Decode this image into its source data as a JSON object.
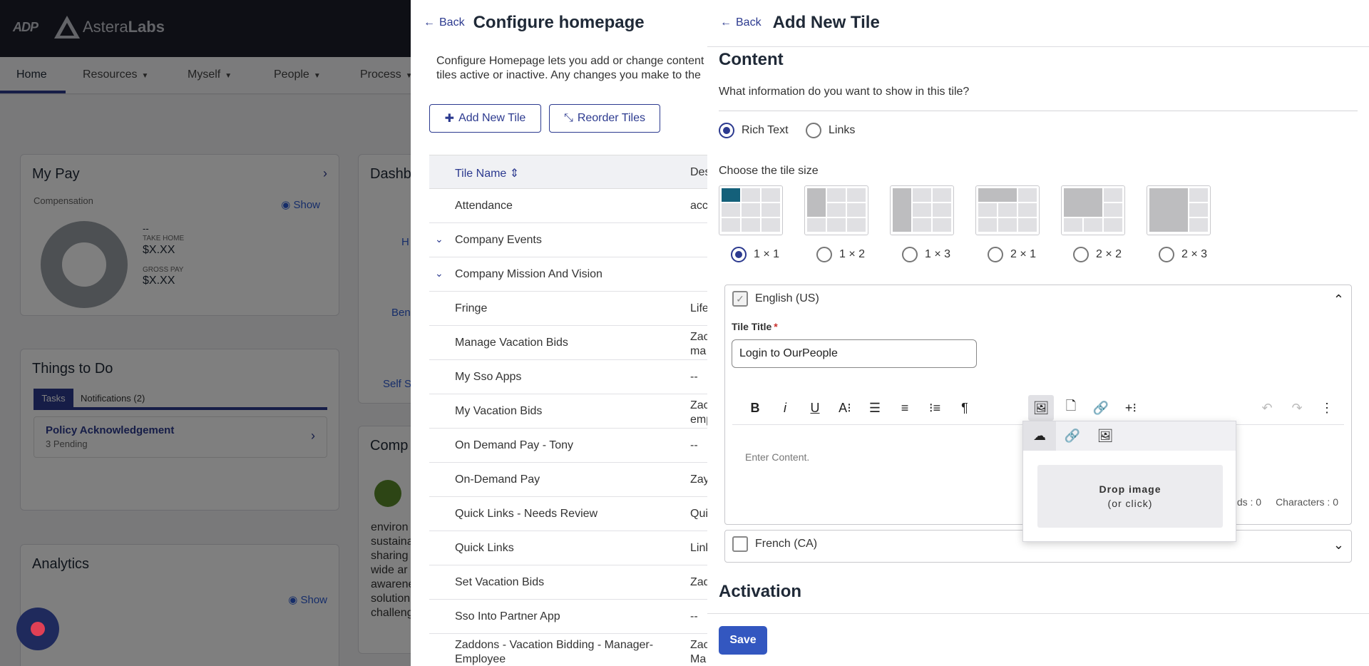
{
  "background": {
    "brand": {
      "adp": "ADP",
      "name_light": "Astera",
      "name_bold": "Labs"
    },
    "nav": [
      {
        "label": "Home"
      },
      {
        "label": "Resources"
      },
      {
        "label": "Myself"
      },
      {
        "label": "People"
      },
      {
        "label": "Process"
      }
    ],
    "my_pay": {
      "title": "My Pay",
      "subtitle": "Compensation",
      "show_label": "Show",
      "dash": "--",
      "take_home_label": "TAKE HOME",
      "take_home_value": "$X.XX",
      "gross_label": "GROSS PAY",
      "gross_value": "$X.XX"
    },
    "things_to_do": {
      "title": "Things to Do",
      "tab_tasks": "Tasks",
      "tab_notifications": "Notifications (2)",
      "task_title": "Policy Acknowledgement",
      "task_sub": "3 Pending"
    },
    "analytics": {
      "title": "Analytics",
      "show_label": "Show"
    },
    "dash_card": {
      "title": "Dashb",
      "l1": "H",
      "l2": "Ben",
      "l3": "Self S"
    },
    "comp_card": {
      "title": "Comp",
      "lines": [
        "environ",
        "sustaina",
        "sharing",
        "wide ar",
        "awarene",
        "solution",
        "challeng"
      ]
    }
  },
  "config_panel": {
    "back_label": "Back",
    "title": "Configure homepage",
    "desc_line1": "Configure Homepage lets you add or change content",
    "desc_line2": "tiles active or inactive. Any changes you make to the",
    "add_tile_label": "Add New Tile",
    "reorder_label": "Reorder Tiles",
    "col_name": "Tile Name",
    "col_desc": "Des",
    "rows": [
      {
        "name": "Attendance",
        "desc": "acc"
      },
      {
        "name": "Company Events",
        "desc": "",
        "expand": true
      },
      {
        "name": "Company Mission And Vision",
        "desc": "",
        "expand": true
      },
      {
        "name": "Fringe",
        "desc": "Life"
      },
      {
        "name": "Manage Vacation Bids",
        "desc": "Zac",
        "desc2": "ma"
      },
      {
        "name": "My Sso Apps",
        "desc": "--"
      },
      {
        "name": "My Vacation Bids",
        "desc": "Zac",
        "desc2": "emp"
      },
      {
        "name": "On Demand Pay - Tony",
        "desc": "--"
      },
      {
        "name": "On-Demand Pay",
        "desc": "Zay"
      },
      {
        "name": "Quick Links - Needs Review",
        "desc": "Qui"
      },
      {
        "name": "Quick Links",
        "desc": "Link"
      },
      {
        "name": "Set Vacation Bids",
        "desc": "Zad"
      },
      {
        "name": "Sso Into Partner App",
        "desc": "--"
      },
      {
        "name": "Zaddons - Vacation Bidding - Manager-",
        "name2": "Employee",
        "desc": "Zac",
        "desc2": "Ma"
      }
    ]
  },
  "drawer": {
    "back_label": "Back",
    "title": "Add New Tile",
    "content_title": "Content",
    "question": "What information do you want to show in this tile?",
    "content_types": [
      {
        "label": "Rich Text",
        "selected": true
      },
      {
        "label": "Links",
        "selected": false
      }
    ],
    "size_label": "Choose the tile size",
    "sizes": [
      {
        "label": "1 × 1",
        "selected": true
      },
      {
        "label": "1 × 2",
        "selected": false
      },
      {
        "label": "1 × 3",
        "selected": false
      },
      {
        "label": "2 × 1",
        "selected": false
      },
      {
        "label": "2 × 2",
        "selected": false
      },
      {
        "label": "2 × 3",
        "selected": false
      }
    ],
    "english": {
      "label": "English (US)",
      "tile_title_label": "Tile Title",
      "required_mark": "*",
      "tile_title_value": "Login to OurPeople",
      "editor_placeholder": "Enter Content.",
      "words_label": "ds : 0",
      "chars_label": "Characters : 0"
    },
    "french": {
      "label": "French (CA)"
    },
    "image_popup": {
      "drop_label": "Drop image",
      "drop_sub": "(or click)"
    },
    "activation_title": "Activation",
    "save_label": "Save"
  }
}
